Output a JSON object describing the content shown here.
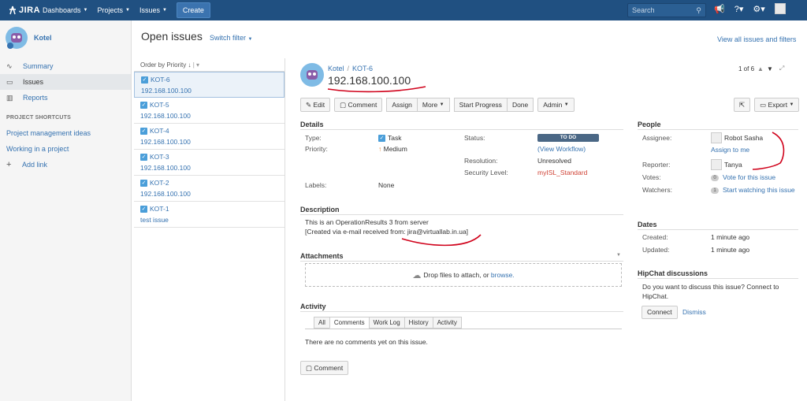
{
  "topnav": {
    "logo": "JIRA",
    "items": [
      "Dashboards",
      "Projects",
      "Issues"
    ],
    "create_label": "Create",
    "search_placeholder": "Search"
  },
  "sidebar": {
    "project_name": "Kotel",
    "items": [
      {
        "label": "Summary",
        "icon": "pulse-icon"
      },
      {
        "label": "Issues",
        "icon": "issues-icon"
      },
      {
        "label": "Reports",
        "icon": "chart-icon"
      }
    ],
    "shortcuts_title": "PROJECT SHORTCUTS",
    "shortcuts": [
      "Project management ideas",
      "Working in a project"
    ],
    "add_link": "Add link"
  },
  "header": {
    "title": "Open issues",
    "switch_filter": "Switch filter",
    "view_all": "View all issues and filters"
  },
  "issue_list": {
    "order_by": "Order by Priority",
    "items": [
      {
        "key": "KOT-6",
        "summary": "192.168.100.100"
      },
      {
        "key": "KOT-5",
        "summary": "192.168.100.100"
      },
      {
        "key": "KOT-4",
        "summary": "192.168.100.100"
      },
      {
        "key": "KOT-3",
        "summary": "192.168.100.100"
      },
      {
        "key": "KOT-2",
        "summary": "192.168.100.100"
      },
      {
        "key": "KOT-1",
        "summary": "test issue"
      }
    ]
  },
  "issue": {
    "project": "Kotel",
    "key": "KOT-6",
    "title": "192.168.100.100",
    "pager": "1 of 6",
    "toolbar": {
      "edit": "Edit",
      "comment": "Comment",
      "assign": "Assign",
      "more": "More",
      "start_progress": "Start Progress",
      "done": "Done",
      "admin": "Admin",
      "export": "Export"
    },
    "details_title": "Details",
    "details": {
      "type_label": "Type:",
      "type_value": "Task",
      "priority_label": "Priority:",
      "priority_value": "Medium",
      "labels_label": "Labels:",
      "labels_value": "None",
      "status_label": "Status:",
      "status_value": "TO DO",
      "view_workflow": "(View Workflow)",
      "resolution_label": "Resolution:",
      "resolution_value": "Unresolved",
      "security_label": "Security Level:",
      "security_value": "myISL_Standard"
    },
    "description_title": "Description",
    "description_line1": "This is an OperationResults 3 from server",
    "description_line2": "[Created via e-mail received from: jira@virtuallab.in.ua]",
    "attachments_title": "Attachments",
    "drop_text": "Drop files to attach, or",
    "browse": "browse.",
    "activity_title": "Activity",
    "tabs": [
      "All",
      "Comments",
      "Work Log",
      "History",
      "Activity"
    ],
    "no_comments": "There are no comments yet on this issue.",
    "comment_button": "Comment"
  },
  "people": {
    "title": "People",
    "assignee_label": "Assignee:",
    "assignee": "Robot Sasha",
    "assign_to_me": "Assign to me",
    "reporter_label": "Reporter:",
    "reporter": "Tanya",
    "votes_label": "Votes:",
    "votes_count": "0",
    "vote_link": "Vote for this issue",
    "watchers_label": "Watchers:",
    "watchers_count": "1",
    "watch_link": "Start watching this issue"
  },
  "dates": {
    "title": "Dates",
    "created_label": "Created:",
    "created": "1 minute ago",
    "updated_label": "Updated:",
    "updated": "1 minute ago"
  },
  "hipchat": {
    "title": "HipChat discussions",
    "text_line1": "Do you want to discuss this issue? Connect to",
    "text_line2": "HipChat.",
    "connect": "Connect",
    "dismiss": "Dismiss"
  },
  "colors": {
    "nav_bg": "#205081",
    "link": "#3572b0",
    "status_lozenge": "#4a6785",
    "annotation": "#d0021b"
  }
}
